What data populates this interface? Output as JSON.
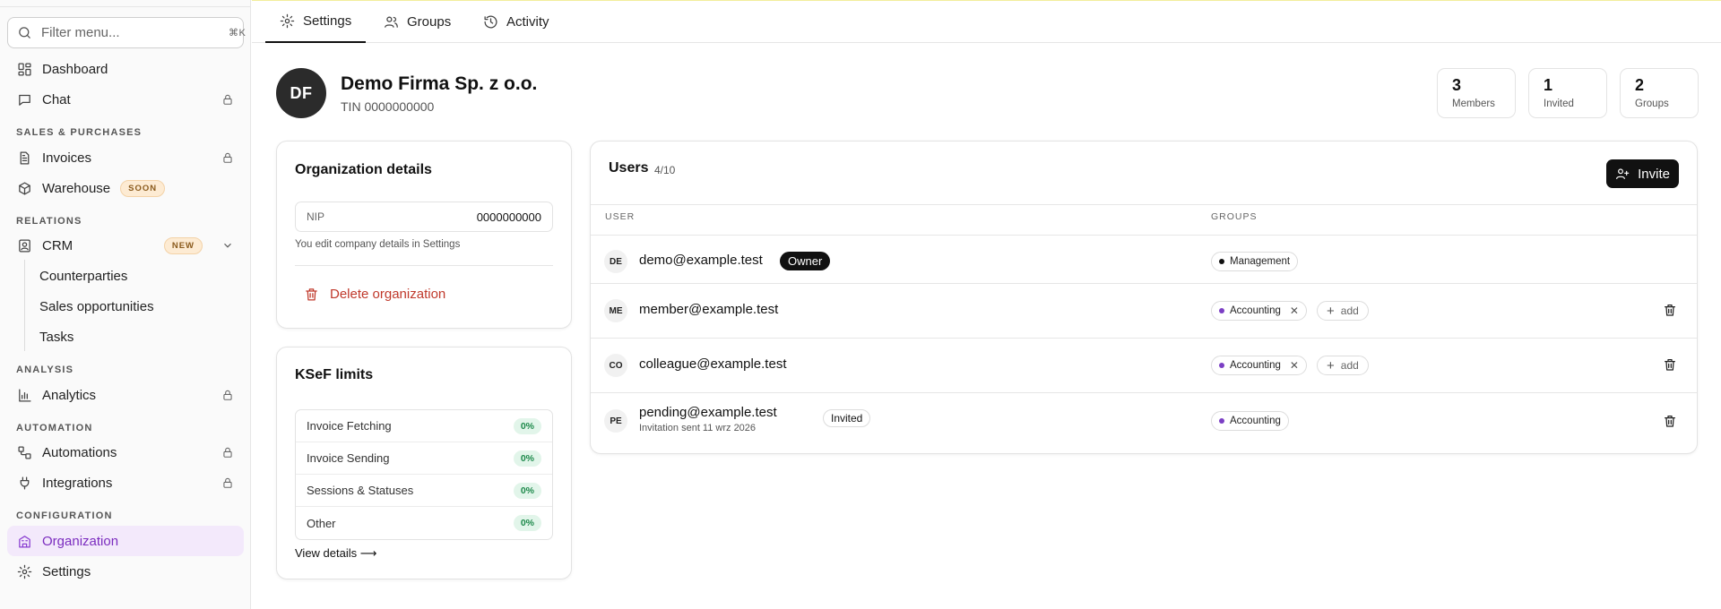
{
  "sidebar": {
    "filter": {
      "placeholder": "Filter menu...",
      "shortcut": "⌘K"
    },
    "items": {
      "dashboard": "Dashboard",
      "chat": "Chat",
      "invoices": "Invoices",
      "warehouse": "Warehouse",
      "crm": "CRM",
      "counterparties": "Counterparties",
      "sales_opportunities": "Sales opportunities",
      "tasks": "Tasks",
      "analytics": "Analytics",
      "automations": "Automations",
      "integrations": "Integrations",
      "organization": "Organization",
      "settings": "Settings"
    },
    "sections": {
      "sales": "SALES & PURCHASES",
      "relations": "RELATIONS",
      "analysis": "ANALYSIS",
      "automation": "AUTOMATION",
      "configuration": "CONFIGURATION"
    },
    "badges": {
      "soon": "SOON",
      "new": "NEW"
    }
  },
  "tabs": {
    "settings": "Settings",
    "groups": "Groups",
    "activity": "Activity"
  },
  "org": {
    "initials": "DF",
    "name": "Demo Firma Sp. z o.o.",
    "tin": "TIN 0000000000",
    "stats": [
      {
        "value": "3",
        "label": "Members"
      },
      {
        "value": "1",
        "label": "Invited"
      },
      {
        "value": "2",
        "label": "Groups"
      }
    ]
  },
  "org_details": {
    "title": "Organization details",
    "nip_label": "NIP",
    "nip_value": "0000000000",
    "hint": "You edit company details in Settings",
    "delete_label": "Delete organization"
  },
  "ksef": {
    "title": "KSeF limits",
    "rows": [
      {
        "label": "Invoice Fetching",
        "value": "0%"
      },
      {
        "label": "Invoice Sending",
        "value": "0%"
      },
      {
        "label": "Sessions & Statuses",
        "value": "0%"
      },
      {
        "label": "Other",
        "value": "0%"
      }
    ],
    "view_details": "View details ⟶"
  },
  "users": {
    "title": "Users",
    "count": "4/10",
    "invite_label": "Invite",
    "columns": {
      "user": "USER",
      "groups": "GROUPS"
    },
    "rows": [
      {
        "initials": "DE",
        "email": "demo@example.test",
        "badge": "Owner",
        "groups": [
          {
            "name": "Management",
            "color": "#111111"
          }
        ]
      },
      {
        "initials": "ME",
        "email": "member@example.test",
        "groups": [
          {
            "name": "Accounting",
            "color": "#7b3fc4"
          }
        ],
        "add_label": "add"
      },
      {
        "initials": "CO",
        "email": "colleague@example.test",
        "groups": [
          {
            "name": "Accounting",
            "color": "#7b3fc4"
          }
        ],
        "add_label": "add"
      },
      {
        "initials": "PE",
        "email": "pending@example.test",
        "badge": "Invited",
        "sub": "Invitation sent 11 wrz 2026",
        "groups": [
          {
            "name": "Accounting",
            "color": "#7b3fc4"
          }
        ]
      }
    ]
  },
  "colors": {
    "accent": "#7b2cbf",
    "danger": "#c0392b",
    "success": "#1f8a4c"
  }
}
